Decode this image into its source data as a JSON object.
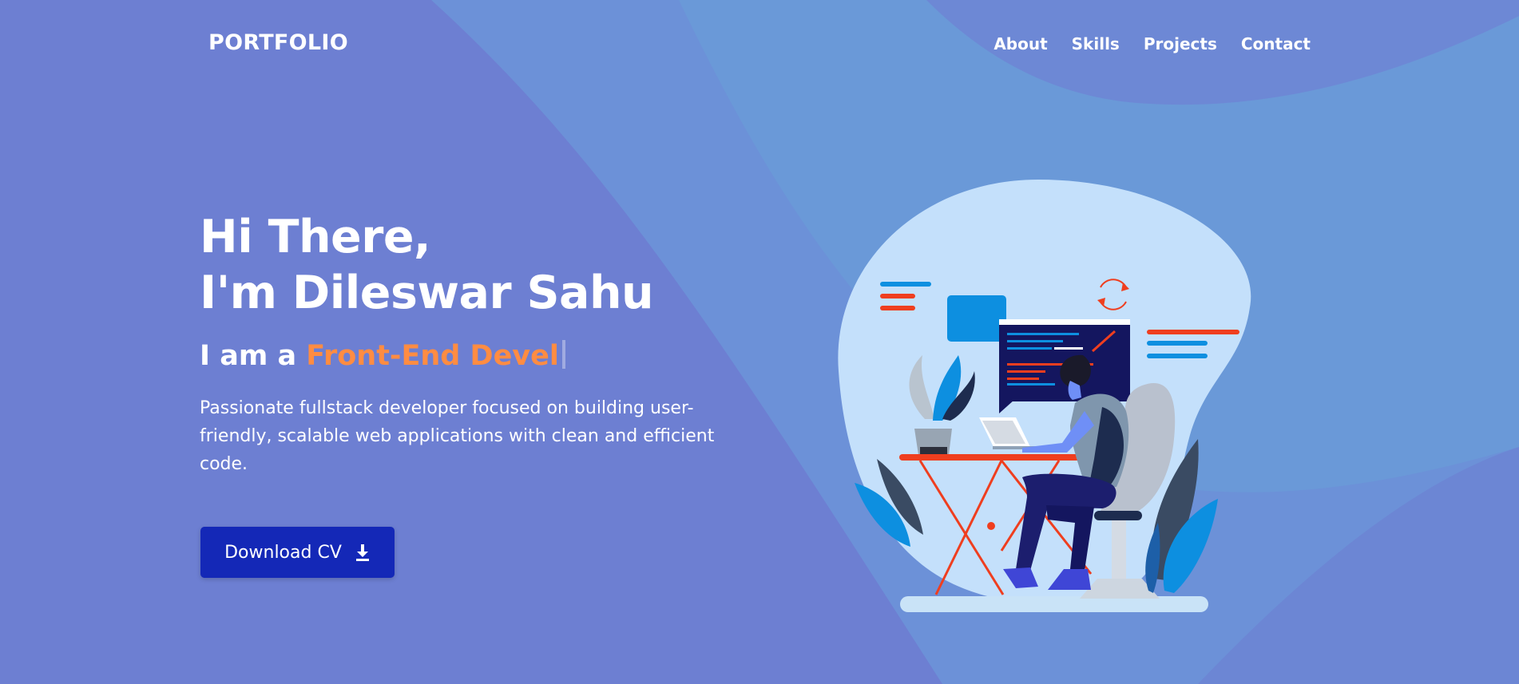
{
  "nav": {
    "logo": "PORTFOLIO",
    "links": [
      "About",
      "Skills",
      "Projects",
      "Contact"
    ]
  },
  "hero": {
    "greeting": "Hi There,",
    "name_line": "I'm Dileswar Sahu",
    "role_prefix": "I am a ",
    "role_typed": "Front-End Devel",
    "description": "Passionate fullstack developer focused on building user-friendly, scalable web applications with clean and efficient code.",
    "cta_label": "Download CV",
    "cta_icon": "download-icon"
  },
  "illustration": {
    "subject": "developer-at-desk-illustration"
  },
  "colors": {
    "background": "#6d7fd2",
    "accent_orange": "#ff8c42",
    "button": "#1428b7",
    "blob": "#c4e0fb",
    "illustration_red": "#ef3e1f",
    "illustration_blue": "#0d8fe0"
  }
}
